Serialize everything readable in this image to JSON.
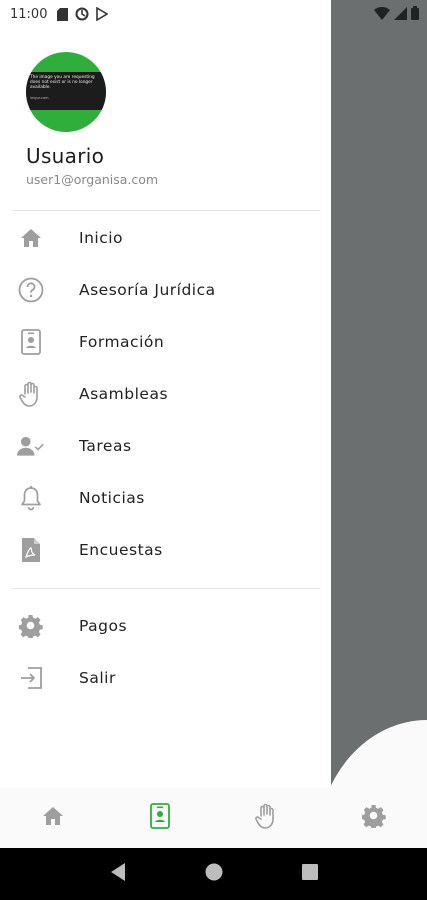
{
  "status_bar": {
    "time": "11:00",
    "left_icons": [
      "sd-card-icon",
      "sync-icon",
      "play-store-icon"
    ],
    "right_icons": [
      "wifi-icon",
      "signal-icon",
      "battery-icon"
    ]
  },
  "profile": {
    "avatar_text": "The image you are requesting does not exist or is no longer available.",
    "avatar_caption": "imgur.com",
    "name": "Usuario",
    "email": "user1@organisa.com"
  },
  "menu": {
    "items": [
      {
        "label": "Inicio",
        "icon": "home-icon"
      },
      {
        "label": "Asesoría Jurídica",
        "icon": "help-circle-icon"
      },
      {
        "label": "Formación",
        "icon": "id-badge-icon"
      },
      {
        "label": "Asambleas",
        "icon": "hand-icon"
      },
      {
        "label": "Tareas",
        "icon": "user-check-icon"
      },
      {
        "label": "Noticias",
        "icon": "bell-icon"
      },
      {
        "label": "Encuestas",
        "icon": "document-icon"
      }
    ],
    "secondary": [
      {
        "label": "Pagos",
        "icon": "gear-icon"
      },
      {
        "label": "Salir",
        "icon": "logout-icon"
      }
    ]
  },
  "bottom_nav": {
    "tabs": [
      {
        "icon": "home-icon",
        "active": false
      },
      {
        "icon": "id-badge-icon",
        "active": true
      },
      {
        "icon": "hand-icon",
        "active": false
      },
      {
        "icon": "gear-icon",
        "active": false
      }
    ]
  },
  "colors": {
    "accent": "#2fae3b",
    "icon_gray": "#9e9e9e",
    "scrim": "#6b6f70"
  }
}
